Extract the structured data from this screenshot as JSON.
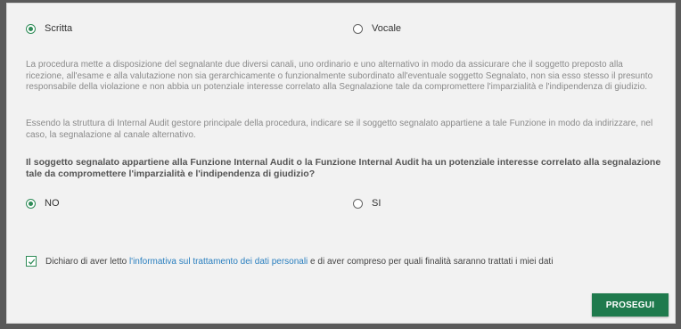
{
  "channel": {
    "option_written": "Scritta",
    "option_voice": "Vocale",
    "selected": "Scritta"
  },
  "info": {
    "paragraph1": "La procedura mette a disposizione del segnalante due diversi canali, uno ordinario e uno alternativo in modo da assicurare che il soggetto preposto alla ricezione, all'esame e alla valutazione non sia gerarchicamente o funzionalmente subordinato all'eventuale soggetto Segnalato, non sia esso stesso il presunto responsabile della violazione e non abbia un potenziale interesse correlato alla Segnalazione tale da compromettere l'imparzialità e l'indipendenza di giudizio.",
    "paragraph2": "Essendo la struttura di Internal Audit gestore principale della procedura, indicare se il soggetto segnalato appartiene a tale Funzione in modo da indirizzare, nel caso, la segnalazione al canale alternativo."
  },
  "question": {
    "text": "Il soggetto segnalato appartiene alla Funzione Internal Audit o la Funzione Internal Audit ha un potenziale interesse correlato alla segnalazione tale da compromettere l'imparzialità e l'indipendenza di giudizio?",
    "option_no": "NO",
    "option_si": "SI",
    "selected": "NO"
  },
  "consent": {
    "prefix": "Dichiaro di aver letto ",
    "link_text": "l'informativa sul trattamento dei dati personali",
    "suffix": " e di aver compreso per quali finalità saranno trattati i miei dati",
    "checked": true
  },
  "actions": {
    "proceed_label": "PROSEGUI"
  },
  "colors": {
    "accent": "#2e8b57",
    "button": "#1f7a4d",
    "link": "#2a7fbf"
  }
}
